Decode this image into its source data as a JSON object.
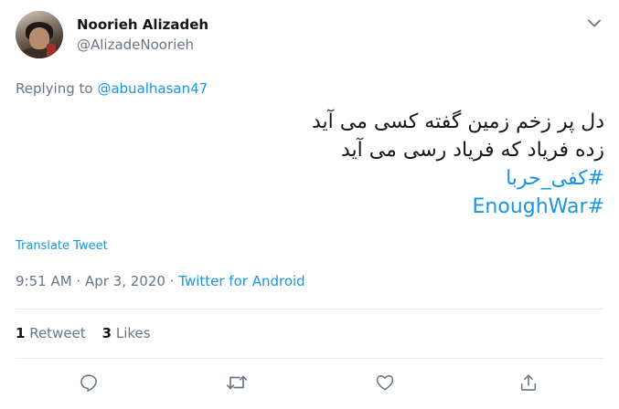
{
  "author": {
    "display_name": "Noorieh Alizadeh",
    "handle": "@AlizadeNoorieh"
  },
  "reply": {
    "prefix": "Replying to ",
    "mention": "@abualhasan47"
  },
  "tweet": {
    "lines": [
      "دل پر زخم زمین گفته کسی می آید",
      "زده فریاد که فریاد رسی می آید"
    ],
    "hashtags": [
      "#کفی_حربا",
      "#EnoughWar"
    ]
  },
  "translate_label": "Translate Tweet",
  "meta": {
    "time": "9:51 AM",
    "separator1": " · ",
    "date": "Apr 3, 2020",
    "separator2": " · ",
    "source": "Twitter for Android"
  },
  "stats": {
    "retweets_count": "1",
    "retweets_label": " Retweet",
    "likes_count": "3",
    "likes_label": " Likes"
  },
  "icons": {
    "caret": "chevron-down-icon",
    "reply": "reply-icon",
    "retweet": "retweet-icon",
    "like": "heart-icon",
    "share": "share-icon"
  },
  "colors": {
    "accent": "#1b95e0",
    "secondary_text": "#657786",
    "primary_text": "#14171a",
    "divider": "#e6ecf0"
  }
}
